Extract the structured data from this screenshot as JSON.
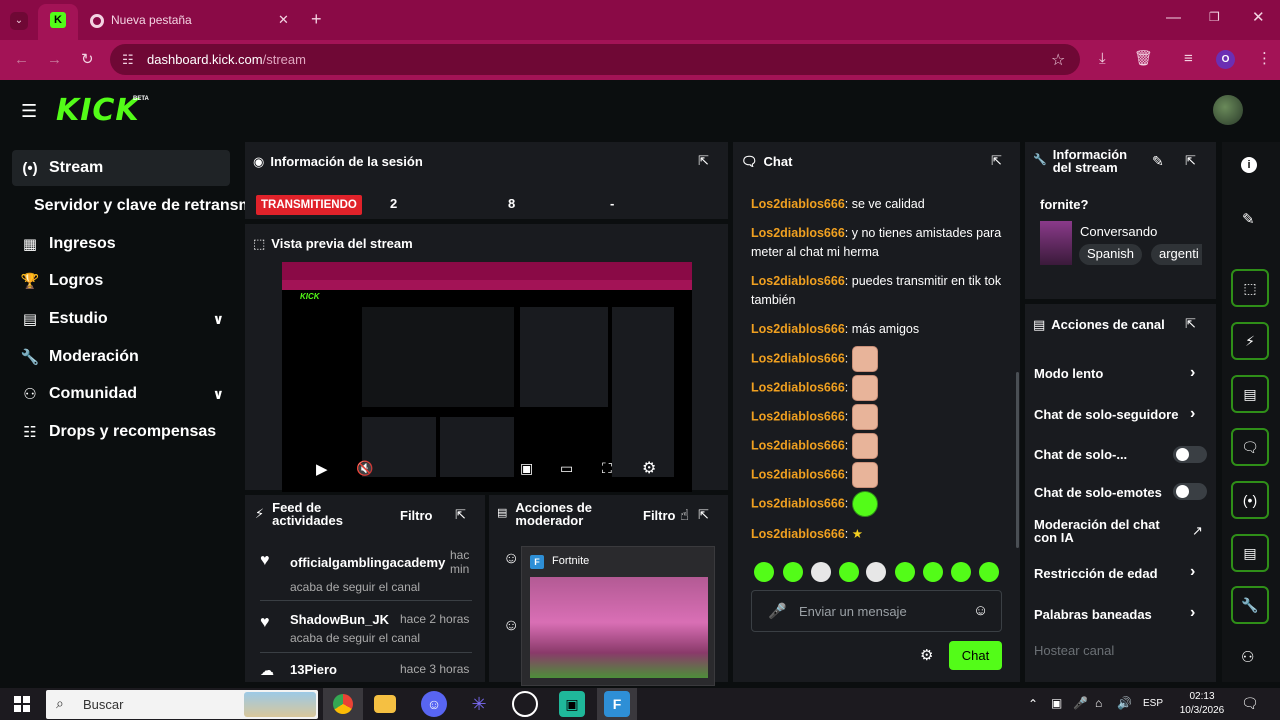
{
  "browser": {
    "tab_title": "Nueva pestaña",
    "url_domain": "dashboard.kick.com",
    "url_path": "/stream",
    "profile_initial": "O",
    "accent_color": "#a31356"
  },
  "kick": {
    "logo_text": "KICK",
    "beta_label": "BETA",
    "brand_color": "#53fc18"
  },
  "sidebar": {
    "items": [
      {
        "label": "Stream",
        "icon": "broadcast-icon"
      },
      {
        "label": "Servidor y clave de retransm",
        "icon": ""
      },
      {
        "label": "Ingresos",
        "icon": "bank-icon"
      },
      {
        "label": "Logros",
        "icon": "trophy-icon"
      },
      {
        "label": "Estudio",
        "icon": "studio-icon"
      },
      {
        "label": "Moderación",
        "icon": "wrench-icon"
      },
      {
        "label": "Comunidad",
        "icon": "users-icon"
      },
      {
        "label": "Drops y recompensas",
        "icon": "drops-icon"
      }
    ]
  },
  "session": {
    "title": "Información de la sesión",
    "live_badge": "TRANSMITIENDO",
    "stat1": "2",
    "stat2": "8",
    "stat3": "-"
  },
  "preview": {
    "title": "Vista previa del stream"
  },
  "activity": {
    "title": "Feed de actividades",
    "filter": "Filtro",
    "items": [
      {
        "name": "officialgamblingacademy",
        "sub": "acaba de seguir el canal",
        "time": "hac min"
      },
      {
        "name": "ShadowBun_JK",
        "sub": "acaba de seguir el canal",
        "time": "hace 2 horas"
      },
      {
        "name": "13Piero",
        "sub": "",
        "time": "hace 3 horas"
      }
    ]
  },
  "mod_actions": {
    "title": "Acciones de moderador",
    "filter": "Filtro"
  },
  "thumbnail": {
    "title": "Fortnite"
  },
  "chat": {
    "title": "Chat",
    "placeholder": "Enviar un mensaje",
    "send_label": "Chat",
    "messages": [
      {
        "user": "Los2diablos666",
        "text": "se ve calidad"
      },
      {
        "user": "Los2diablos666",
        "text": "y no tienes amistades para meter al chat mi herma"
      },
      {
        "user": "Los2diablos666",
        "text": "puedes transmitir en tik tok también"
      },
      {
        "user": "Los2diablos666",
        "text": "más amigos"
      },
      {
        "user": "Los2diablos666",
        "text": ""
      },
      {
        "user": "Los2diablos666",
        "text": ""
      },
      {
        "user": "Los2diablos666",
        "text": ""
      },
      {
        "user": "Los2diablos666",
        "text": ""
      },
      {
        "user": "Los2diablos666",
        "text": ""
      },
      {
        "user": "Los2diablos666",
        "text": ""
      },
      {
        "user": "Los2diablos666",
        "text": ""
      }
    ]
  },
  "stream_info": {
    "title": "Información del stream",
    "stream_title": "fornite?",
    "category": "Conversando",
    "tags": [
      "Spanish",
      "argenti"
    ]
  },
  "channel_actions": {
    "title": "Acciones de canal",
    "rows": [
      {
        "label": "Modo lento",
        "control": "chevron"
      },
      {
        "label": "Chat de solo-seguidore",
        "control": "chevron"
      },
      {
        "label": "Chat de solo-...",
        "control": "toggle-off"
      },
      {
        "label": "Chat de solo-emotes",
        "control": "toggle-off"
      },
      {
        "label": "Moderación del chat con IA",
        "control": "external"
      },
      {
        "label": "Restricción de edad",
        "control": "chevron"
      },
      {
        "label": "Palabras baneadas",
        "control": "chevron"
      },
      {
        "label": "Hostear canal",
        "control": "disabled"
      }
    ]
  },
  "taskbar": {
    "search_placeholder": "Buscar",
    "time": "02:13",
    "date": "10/3/2026",
    "lang": "ESP"
  }
}
